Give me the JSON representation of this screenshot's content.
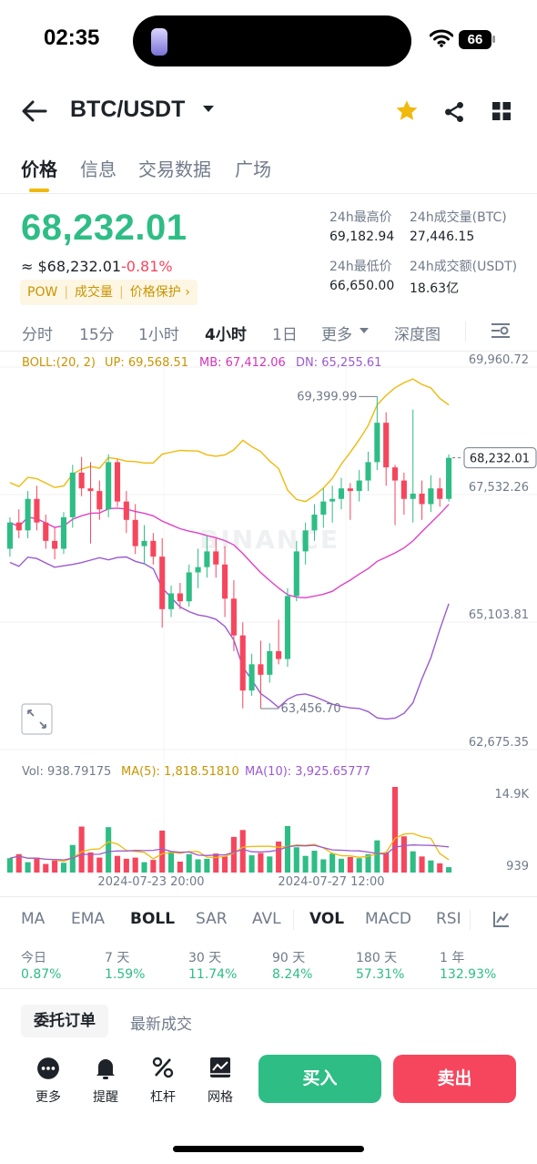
{
  "status": {
    "time": "02:35",
    "battery": "66"
  },
  "header": {
    "pair": "BTC/USDT"
  },
  "tabs": [
    "价格",
    "信息",
    "交易数据",
    "广场"
  ],
  "price": {
    "last": "68,232.01",
    "fiat": "≈ $68,232.01",
    "change": "-0.81%",
    "tags": [
      "POW",
      "成交量",
      "价格保护 ›"
    ]
  },
  "stats": {
    "high_label": "24h最高价",
    "high": "69,182.94",
    "vol_btc_label": "24h成交量(BTC)",
    "vol_btc": "27,446.15",
    "low_label": "24h最低价",
    "low": "66,650.00",
    "vol_usdt_label": "24h成交额(USDT)",
    "vol_usdt": "18.63亿"
  },
  "timeframes": [
    "分时",
    "15分",
    "1小时",
    "4小时",
    "1日",
    "更多",
    "深度图"
  ],
  "timeframe_active": "4小时",
  "boll": {
    "label": "BOLL:(20, 2)",
    "up": "UP: 69,568.51",
    "mb": "MB: 67,412.06",
    "dn": "DN: 65,255.61"
  },
  "chart_axis": {
    "y_labels": [
      "69,960.72",
      "67,532.26",
      "65,103.81",
      "62,675.35"
    ],
    "current_price": "68,232.01",
    "high_marker": "69,399.99",
    "low_marker": "63,456.70",
    "watermark": "BINANCE"
  },
  "volume": {
    "vol": "Vol: 938.79175",
    "ma5": "MA(5): 1,818.51810",
    "ma10": "MA(10): 3,925.65777",
    "max_label": "14.9K",
    "min_label": "939",
    "dates": [
      "2024-07-23 20:00",
      "2024-07-27 12:00"
    ]
  },
  "indicators": [
    "MA",
    "EMA",
    "BOLL",
    "SAR",
    "AVL",
    "VOL",
    "MACD",
    "RSI"
  ],
  "indicators_active": [
    "BOLL",
    "VOL"
  ],
  "performance": [
    {
      "label": "今日",
      "value": "0.87%"
    },
    {
      "label": "7 天",
      "value": "1.59%"
    },
    {
      "label": "30 天",
      "value": "11.74%"
    },
    {
      "label": "90 天",
      "value": "8.24%"
    },
    {
      "label": "180 天",
      "value": "57.31%"
    },
    {
      "label": "1 年",
      "value": "132.93%"
    }
  ],
  "orders": {
    "tab_active": "委托订单",
    "tab_other": "最新成交"
  },
  "bottom_nav": [
    "更多",
    "提醒",
    "杠杆",
    "网格"
  ],
  "actions": {
    "buy": "买入",
    "sell": "卖出"
  },
  "colors": {
    "up": "#2ebd85",
    "down": "#f6465d",
    "accent": "#f0b90b",
    "boll_up": "#f0b90b",
    "boll_mb": "#e040c8",
    "boll_dn": "#9b59d0"
  },
  "chart_data": {
    "type": "candlestick",
    "ylim": [
      62675.35,
      69960.72
    ],
    "y_ticks": [
      69960.72,
      67532.26,
      65103.81,
      62675.35
    ],
    "candles": [
      [
        66500,
        67100,
        66350,
        67000
      ],
      [
        67000,
        67250,
        66700,
        66850
      ],
      [
        66850,
        67600,
        66700,
        67450
      ],
      [
        67450,
        67700,
        66850,
        67000
      ],
      [
        67000,
        67150,
        66500,
        66650
      ],
      [
        66650,
        66900,
        66300,
        66500
      ],
      [
        66500,
        67200,
        66400,
        67100
      ],
      [
        67100,
        68100,
        66900,
        67950
      ],
      [
        67950,
        68250,
        67500,
        67650
      ],
      [
        67650,
        68150,
        66600,
        67600
      ],
      [
        67600,
        67800,
        67050,
        67250
      ],
      [
        67250,
        68300,
        67100,
        68150
      ],
      [
        68150,
        68200,
        67300,
        67400
      ],
      [
        67400,
        67600,
        66800,
        67050
      ],
      [
        67050,
        67350,
        66400,
        66550
      ],
      [
        66550,
        66950,
        66200,
        66650
      ],
      [
        66650,
        66800,
        66200,
        66350
      ],
      [
        66350,
        66700,
        65000,
        65350
      ],
      [
        65350,
        65800,
        65200,
        65650
      ],
      [
        65650,
        65850,
        65350,
        65500
      ],
      [
        65500,
        66200,
        65400,
        66050
      ],
      [
        66050,
        66500,
        65750,
        66150
      ],
      [
        66150,
        66750,
        65950,
        66450
      ],
      [
        66450,
        66700,
        65950,
        66200
      ],
      [
        66200,
        66550,
        65200,
        65550
      ],
      [
        65550,
        65900,
        64550,
        64850
      ],
      [
        64850,
        65100,
        63460,
        63800
      ],
      [
        63800,
        64500,
        63700,
        64300
      ],
      [
        64300,
        64750,
        63456,
        64100
      ],
      [
        64100,
        64700,
        63950,
        64550
      ],
      [
        64550,
        65150,
        64300,
        64400
      ],
      [
        64400,
        65750,
        64250,
        65600
      ],
      [
        65600,
        66650,
        65500,
        66450
      ],
      [
        66450,
        67000,
        66200,
        66850
      ],
      [
        66850,
        67350,
        66650,
        67150
      ],
      [
        67150,
        67650,
        66900,
        67400
      ],
      [
        67400,
        67700,
        67000,
        67450
      ],
      [
        67450,
        67850,
        67250,
        67650
      ],
      [
        67650,
        67750,
        67050,
        67600
      ],
      [
        67600,
        68000,
        67400,
        67800
      ],
      [
        67800,
        68350,
        67600,
        68150
      ],
      [
        68150,
        69400,
        68000,
        68900
      ],
      [
        68900,
        69100,
        67700,
        68050
      ],
      [
        68050,
        68100,
        66950,
        67800
      ],
      [
        67800,
        67950,
        67150,
        67450
      ],
      [
        67450,
        69150,
        67000,
        67550
      ],
      [
        67550,
        67800,
        67050,
        67350
      ],
      [
        67350,
        67900,
        67200,
        67650
      ],
      [
        67650,
        67850,
        67300,
        67450
      ],
      [
        67450,
        68300,
        67400,
        68232
      ]
    ],
    "boll_upper_end": 69568.51,
    "boll_middle_end": 67412.06,
    "boll_lower_end": 65255.61,
    "volume_ylim": [
      0,
      14900
    ],
    "volume": [
      2500,
      3200,
      1800,
      2600,
      1500,
      2100,
      1700,
      4800,
      8000,
      3500,
      2600,
      7900,
      2900,
      2400,
      2600,
      1800,
      2200,
      7300,
      3600,
      1900,
      3200,
      2300,
      2400,
      3300,
      2800,
      6200,
      7400,
      3000,
      3400,
      2800,
      5400,
      8100,
      4400,
      2900,
      3800,
      2300,
      3300,
      2400,
      2700,
      2500,
      3200,
      5600,
      3500,
      14900,
      6300,
      3700,
      2800,
      2100,
      1600,
      939
    ],
    "volume_dates": [
      "2024-07-23 20:00",
      "2024-07-27 12:00"
    ]
  }
}
